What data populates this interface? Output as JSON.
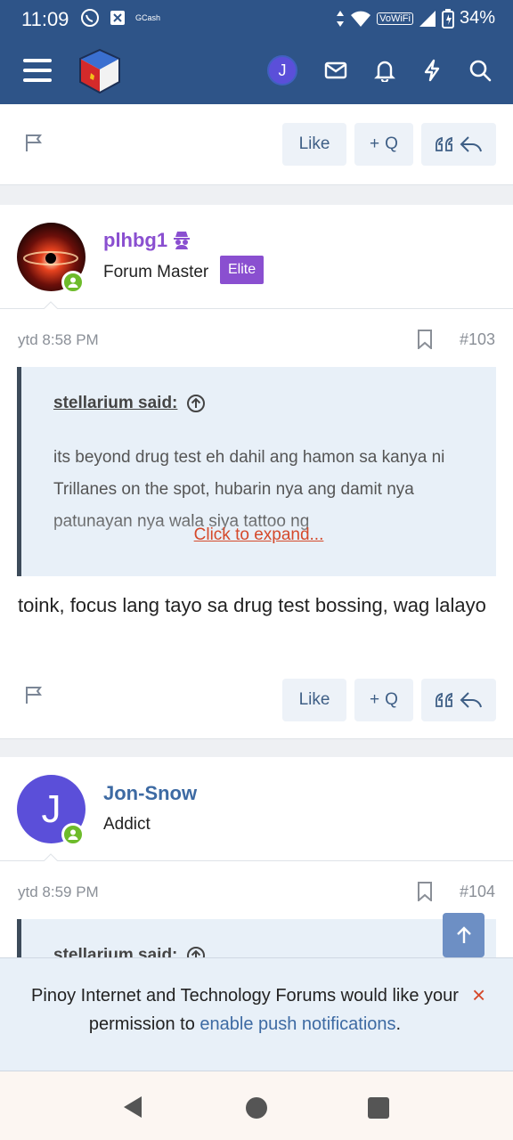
{
  "status_bar": {
    "time": "11:09",
    "notif_gcash": "GCash",
    "vowifi": "VoWiFi",
    "battery": "34%"
  },
  "app_bar": {
    "account_initial": "J",
    "icons": [
      "menu-icon",
      "site-logo",
      "account-avatar",
      "inbox-icon",
      "bell-icon",
      "lightning-icon",
      "search-icon"
    ]
  },
  "post_actions": {
    "like": "Like",
    "quote": "Q"
  },
  "posts": [
    {
      "username": "plhbg1",
      "user_title": "Forum Master",
      "badge": "Elite",
      "time": "ytd 8:58 PM",
      "number": "#103",
      "quote_author": "stellarium said:",
      "quote_text": "its beyond drug test eh dahil ang hamon sa kanya ni Trillanes on the spot, hubarin nya ang damit nya patunayan nya wala siya tattoo ng",
      "expand": "Click to expand...",
      "body": "toink, focus lang tayo sa drug test bossing, wag lalayo"
    },
    {
      "username": "Jon-Snow",
      "avatar_initial": "J",
      "user_title": "Addict",
      "time": "ytd 8:59 PM",
      "number": "#104",
      "quote_author": "stellarium said:"
    }
  ],
  "notice": {
    "text_before": "Pinoy Internet and Technology Forums would like your permission to ",
    "link": "enable push notifications",
    "text_after": ".",
    "close": "×"
  },
  "colors": {
    "header_blue": "#2e5488",
    "elite_purple": "#8a4fd0",
    "username_purple": "#8a4fd0",
    "username_blue": "#3d6aa3",
    "online_green": "#6dbb2a",
    "link_red": "#d5492b"
  }
}
